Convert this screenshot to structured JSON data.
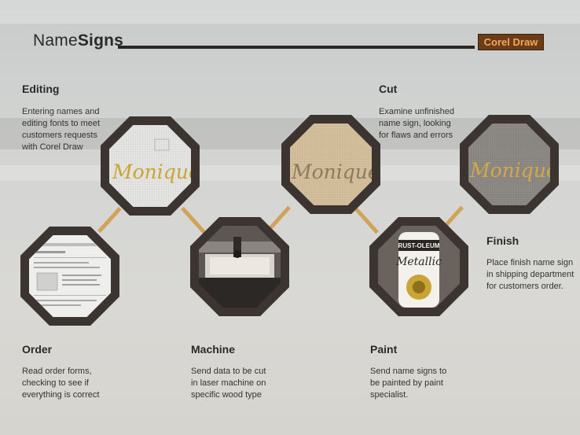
{
  "header": {
    "title_light": "Name",
    "title_bold": "Signs",
    "badge": "Corel Draw"
  },
  "steps": {
    "editing": {
      "title": "Editing",
      "desc": [
        "Entering names and",
        "editing fonts to meet",
        "customers requests",
        "with Corel Draw"
      ]
    },
    "cut": {
      "title": "Cut",
      "desc": [
        "Examine unfinished",
        "name sign, looking",
        "for flaws and errors"
      ]
    },
    "finish": {
      "title": "Finish",
      "desc": [
        "Place finish name sign",
        "in shipping department",
        "for customers order."
      ]
    },
    "order": {
      "title": "Order",
      "desc": [
        "Read order forms,",
        "checking to see if",
        "everything is correct"
      ]
    },
    "machine": {
      "title": "Machine",
      "desc": [
        "Send data to be cut",
        "in laser machine on",
        "specific wood type"
      ]
    },
    "paint": {
      "title": "Paint",
      "desc": [
        "Send name signs to",
        "be painted by paint",
        "specialist."
      ]
    }
  },
  "images": {
    "sign_text": "Moniques",
    "can_brand": "RUST-OLEUM",
    "can_product": "Metallic"
  },
  "colors": {
    "badge_bg": "#6b3c17",
    "badge_text": "#f0a75b",
    "octagon_frame": "#3b3431",
    "connector": "#d2a25a",
    "sign_gold": "#c9a534"
  }
}
